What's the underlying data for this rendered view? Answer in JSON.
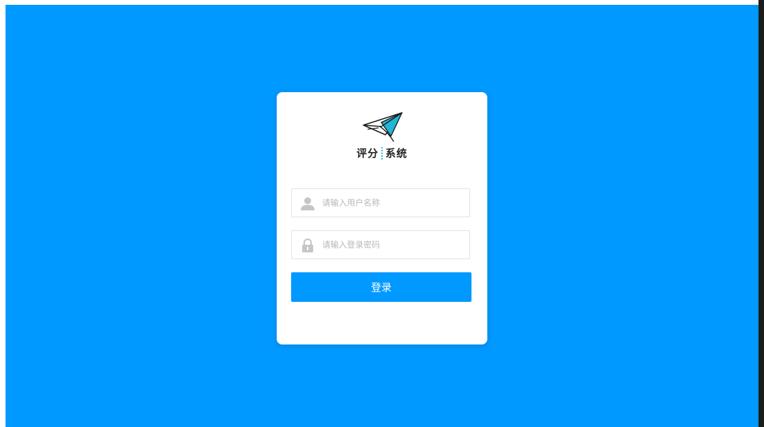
{
  "logo": {
    "part1": "评分",
    "part2": "系统",
    "icon": "paper-plane-icon"
  },
  "form": {
    "username": {
      "placeholder": "请输入用户名称",
      "value": "",
      "icon": "user-icon"
    },
    "password": {
      "placeholder": "请输入登录密码",
      "value": "",
      "icon": "lock-icon"
    },
    "submit_label": "登录"
  },
  "colors": {
    "background": "#0099ff",
    "button": "#0099ff",
    "accent": "#2fb9d9"
  }
}
